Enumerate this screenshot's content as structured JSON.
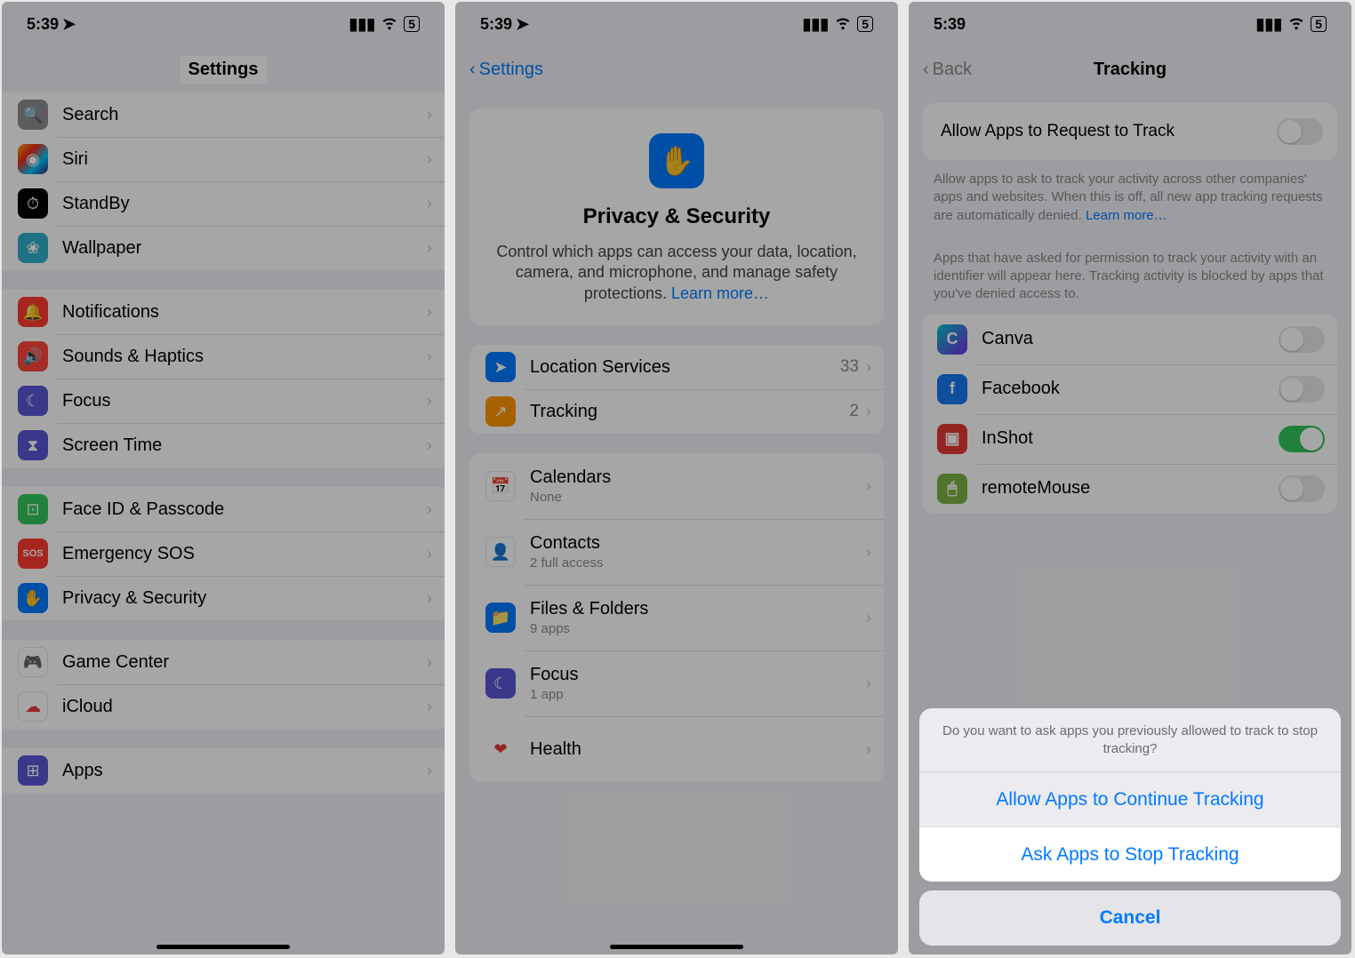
{
  "status": {
    "time": "5:39",
    "battery": "5"
  },
  "screen1": {
    "title": "Settings",
    "groups": [
      {
        "items": [
          {
            "icon": "search-icon",
            "color": "ic-gray",
            "label": "Search"
          },
          {
            "icon": "siri-icon",
            "color": "ic-mixed",
            "label": "Siri"
          },
          {
            "icon": "standby-icon",
            "color": "ic-black",
            "label": "StandBy"
          },
          {
            "icon": "wallpaper-icon",
            "color": "ic-teal",
            "label": "Wallpaper"
          }
        ]
      },
      {
        "items": [
          {
            "icon": "bell-icon",
            "color": "ic-red",
            "label": "Notifications"
          },
          {
            "icon": "speaker-icon",
            "color": "ic-red2",
            "label": "Sounds & Haptics"
          },
          {
            "icon": "moon-icon",
            "color": "ic-purple",
            "label": "Focus"
          },
          {
            "icon": "hourglass-icon",
            "color": "ic-hourglass",
            "label": "Screen Time"
          }
        ]
      },
      {
        "items": [
          {
            "icon": "faceid-icon",
            "color": "ic-green",
            "label": "Face ID & Passcode"
          },
          {
            "icon": "sos-icon",
            "color": "ic-red",
            "label": "Emergency SOS"
          },
          {
            "icon": "hand-icon",
            "color": "ic-blue",
            "label": "Privacy & Security",
            "highlighted": true
          }
        ]
      },
      {
        "items": [
          {
            "icon": "gamecenter-icon",
            "color": "ic-white",
            "label": "Game Center"
          },
          {
            "icon": "icloud-icon",
            "color": "ic-white",
            "label": "iCloud"
          }
        ]
      },
      {
        "items": [
          {
            "icon": "apps-icon",
            "color": "ic-purple",
            "label": "Apps"
          }
        ]
      }
    ]
  },
  "screen2": {
    "back": "Settings",
    "card": {
      "title": "Privacy & Security",
      "desc": "Control which apps can access your data, location, camera, and microphone, and manage safety protections.",
      "learn": "Learn more…"
    },
    "group1": [
      {
        "icon": "location-icon",
        "color": "ic-blue",
        "label": "Location Services",
        "value": "33"
      },
      {
        "icon": "tracking-icon",
        "color": "ic-orange",
        "label": "Tracking",
        "value": "2",
        "highlighted": true
      }
    ],
    "group2": [
      {
        "icon": "calendar-icon",
        "color": "ic-white",
        "label": "Calendars",
        "sub": "None"
      },
      {
        "icon": "contacts-icon",
        "color": "ic-white",
        "label": "Contacts",
        "sub": "2 full access"
      },
      {
        "icon": "files-icon",
        "color": "ic-blue",
        "label": "Files & Folders",
        "sub": "9 apps"
      },
      {
        "icon": "focus-icon",
        "color": "ic-purple",
        "label": "Focus",
        "sub": "1 app"
      },
      {
        "icon": "health-icon",
        "color": "ic-pink",
        "label": "Health",
        "sub": ""
      }
    ]
  },
  "screen3": {
    "back": "Back",
    "title": "Tracking",
    "allow_label": "Allow Apps to Request to Track",
    "allow_desc": "Allow apps to ask to track your activity across other companies' apps and websites. When this is off, all new app tracking requests are automatically denied.",
    "learn": "Learn more…",
    "apps_desc": "Apps that have asked for permission to track your activity with an identifier will appear here. Tracking activity is blocked by apps that you've denied access to.",
    "apps": [
      {
        "icon": "canva-icon",
        "color": "ic-canva",
        "label": "Canva",
        "on": false
      },
      {
        "icon": "facebook-icon",
        "color": "ic-fb",
        "label": "Facebook",
        "on": false
      },
      {
        "icon": "inshot-icon",
        "color": "ic-inshot",
        "label": "InShot",
        "on": true
      },
      {
        "icon": "remotemouse-icon",
        "color": "ic-rmouse",
        "label": "remoteMouse",
        "on": false
      }
    ],
    "sheet": {
      "msg": "Do you want to ask apps you previously allowed to track to stop tracking?",
      "continue": "Allow Apps to Continue Tracking",
      "stop": "Ask Apps to Stop Tracking",
      "cancel": "Cancel"
    }
  }
}
